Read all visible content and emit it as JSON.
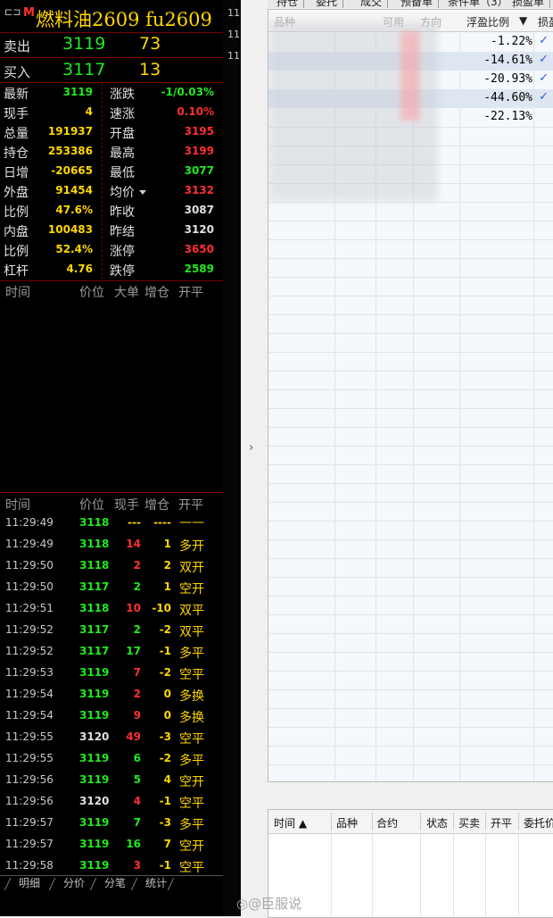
{
  "header": {
    "icon_text": "⊏⊐",
    "market_badge": "M",
    "title": "燃料油2609 fu2609"
  },
  "orderbook": {
    "ask": {
      "label": "卖出",
      "price": "3119",
      "qty": "73"
    },
    "bid": {
      "label": "买入",
      "price": "3117",
      "qty": "13"
    }
  },
  "quote": {
    "rows": [
      {
        "l1": "最新",
        "v1": "3119",
        "c1": "#1eeb1e",
        "l2": "涨跌",
        "v2": "-1/0.03%",
        "c2": "#1eeb1e"
      },
      {
        "l1": "现手",
        "v1": "4",
        "c1": "#ffd700",
        "l2": "速涨",
        "v2": "0.10%",
        "c2": "#ff3030"
      },
      {
        "l1": "总量",
        "v1": "191937",
        "c1": "#ffd700",
        "l2": "开盘",
        "v2": "3195",
        "c2": "#ff3030"
      },
      {
        "l1": "持仓",
        "v1": "253386",
        "c1": "#ffd700",
        "l2": "最高",
        "v2": "3199",
        "c2": "#ff3030"
      },
      {
        "l1": "日增",
        "v1": "-20665",
        "c1": "#ffd700",
        "l2": "最低",
        "v2": "3077",
        "c2": "#1eeb1e"
      },
      {
        "l1": "外盘",
        "v1": "91454",
        "c1": "#ffd700",
        "l2": "均价",
        "v2": "3132",
        "c2": "#ff3030"
      },
      {
        "l1": "比例",
        "v1": "47.6%",
        "c1": "#ffd700",
        "l2": "昨收",
        "v2": "3087",
        "c2": "#e0e0e0"
      },
      {
        "l1": "内盘",
        "v1": "100483",
        "c1": "#ffd700",
        "l2": "昨结",
        "v2": "3120",
        "c2": "#e0e0e0"
      },
      {
        "l1": "比例",
        "v1": "52.4%",
        "c1": "#ffd700",
        "l2": "涨停",
        "v2": "3650",
        "c2": "#ff3030"
      },
      {
        "l1": "杠杆",
        "v1": "4.76",
        "c1": "#ffd700",
        "l2": "跌停",
        "v2": "2589",
        "c2": "#1eeb1e"
      }
    ]
  },
  "bigorders": {
    "headers": {
      "time": "时间",
      "price": "价位",
      "big": "大单",
      "oi": "增仓",
      "oc": "开平"
    }
  },
  "ticks": {
    "headers": {
      "time": "时间",
      "price": "价位",
      "vol": "现手",
      "oi": "增仓",
      "oc": "开平"
    },
    "rows": [
      {
        "time": "11:29:49",
        "price": "3118",
        "pc": "#1eeb1e",
        "vol": "---",
        "vc": "#ffd700",
        "oi": "----",
        "oc": "——"
      },
      {
        "time": "11:29:49",
        "price": "3118",
        "pc": "#1eeb1e",
        "vol": "14",
        "vc": "#ff3030",
        "oi": "1",
        "oc": "多开"
      },
      {
        "time": "11:29:50",
        "price": "3118",
        "pc": "#1eeb1e",
        "vol": "2",
        "vc": "#ff3030",
        "oi": "2",
        "oc": "双开"
      },
      {
        "time": "11:29:50",
        "price": "3117",
        "pc": "#1eeb1e",
        "vol": "2",
        "vc": "#1eeb1e",
        "oi": "1",
        "oc": "空开"
      },
      {
        "time": "11:29:51",
        "price": "3118",
        "pc": "#1eeb1e",
        "vol": "10",
        "vc": "#ff3030",
        "oi": "-10",
        "oc": "双平"
      },
      {
        "time": "11:29:52",
        "price": "3117",
        "pc": "#1eeb1e",
        "vol": "2",
        "vc": "#1eeb1e",
        "oi": "-2",
        "oc": "双平"
      },
      {
        "time": "11:29:52",
        "price": "3117",
        "pc": "#1eeb1e",
        "vol": "17",
        "vc": "#1eeb1e",
        "oi": "-1",
        "oc": "多平"
      },
      {
        "time": "11:29:53",
        "price": "3119",
        "pc": "#1eeb1e",
        "vol": "7",
        "vc": "#ff3030",
        "oi": "-2",
        "oc": "空平"
      },
      {
        "time": "11:29:54",
        "price": "3119",
        "pc": "#1eeb1e",
        "vol": "2",
        "vc": "#ff3030",
        "oi": "0",
        "oc": "多换"
      },
      {
        "time": "11:29:54",
        "price": "3119",
        "pc": "#1eeb1e",
        "vol": "9",
        "vc": "#ff3030",
        "oi": "0",
        "oc": "多换"
      },
      {
        "time": "11:29:55",
        "price": "3120",
        "pc": "#e0e0e0",
        "vol": "49",
        "vc": "#ff3030",
        "oi": "-3",
        "oc": "空平"
      },
      {
        "time": "11:29:55",
        "price": "3119",
        "pc": "#1eeb1e",
        "vol": "6",
        "vc": "#1eeb1e",
        "oi": "-2",
        "oc": "多平"
      },
      {
        "time": "11:29:56",
        "price": "3119",
        "pc": "#1eeb1e",
        "vol": "5",
        "vc": "#1eeb1e",
        "oi": "4",
        "oc": "空开"
      },
      {
        "time": "11:29:56",
        "price": "3120",
        "pc": "#e0e0e0",
        "vol": "4",
        "vc": "#ff3030",
        "oi": "-1",
        "oc": "空平"
      },
      {
        "time": "11:29:57",
        "price": "3119",
        "pc": "#1eeb1e",
        "vol": "7",
        "vc": "#1eeb1e",
        "oi": "-3",
        "oc": "多平"
      },
      {
        "time": "11:29:57",
        "price": "3119",
        "pc": "#1eeb1e",
        "vol": "16",
        "vc": "#1eeb1e",
        "oi": "7",
        "oc": "空开"
      },
      {
        "time": "11:29:58",
        "price": "3119",
        "pc": "#1eeb1e",
        "vol": "3",
        "vc": "#ff3030",
        "oi": "-1",
        "oc": "空平"
      }
    ]
  },
  "bottom_tabs": [
    "明细",
    "分价",
    "分笔",
    "统计"
  ],
  "divider_labels": [
    "11",
    "11",
    "11"
  ],
  "collapse_arrow": "›",
  "right_tabs": [
    "持仓",
    "委托",
    "成交",
    "预备单",
    "条件单（3）",
    "损盈单"
  ],
  "positions": {
    "headers": {
      "name": "品种",
      "avail": "可用",
      "dir": "方向",
      "float_ratio": "浮盈比例",
      "sort_arrow": "▼",
      "stop": "损盈"
    },
    "rows": [
      {
        "ratio": "-1.22%",
        "check": "✓"
      },
      {
        "ratio": "-14.61%",
        "check": "✓"
      },
      {
        "ratio": "-20.93%",
        "check": "✓"
      },
      {
        "ratio": "-44.60%",
        "check": "✓"
      },
      {
        "ratio": "-22.13%",
        "check": ""
      }
    ]
  },
  "orders": {
    "headers": [
      "时间 ▲",
      "品种",
      "合约",
      "状态",
      "买卖",
      "开平",
      "委托价"
    ]
  },
  "watermark": "◎@臣服说"
}
